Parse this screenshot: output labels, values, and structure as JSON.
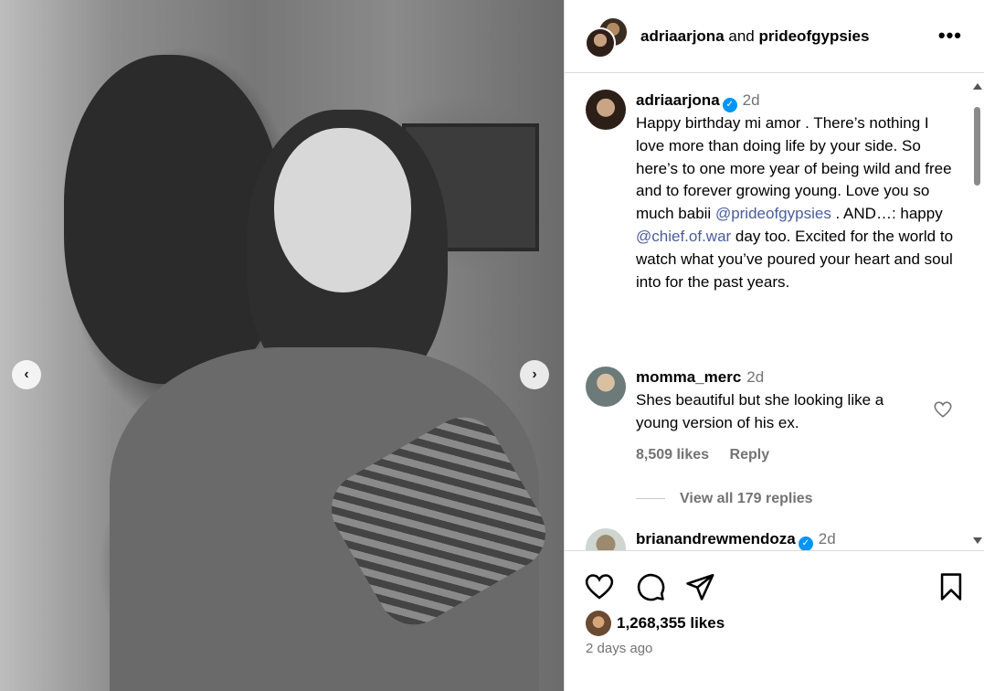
{
  "header": {
    "user1": "adriaarjona",
    "joiner": "and",
    "user2": "prideofgypsies",
    "more_label": "•••"
  },
  "photo": {
    "prev_label": "‹",
    "next_label": "›"
  },
  "caption": {
    "username": "adriaarjona",
    "verified_icon": "verified-badge-icon",
    "time": "2d",
    "text_1": "Happy birthday mi amor . There’s nothing I love more than doing life by your side. So here’s to one more year of being wild and free and to forever growing young. Love you so much babii ",
    "mention_1": "@prideofgypsies",
    "text_2": " . AND…: happy ",
    "mention_2": "@chief.of.war",
    "text_3": " day too. Excited for the world to watch what you’ve poured your heart and soul into for the past years."
  },
  "comments": [
    {
      "username": "momma_merc",
      "time": "2d",
      "text": "Shes beautiful but she looking like a young version of his ex.",
      "likes": "8,509 likes",
      "reply": "Reply",
      "view_replies": "View all 179 replies"
    },
    {
      "username": "brianandrewmendoza",
      "time": "2d"
    }
  ],
  "actions": {
    "likes": "1,268,355 likes",
    "posted": "2 days ago"
  },
  "colors": {
    "mention": "#4a5d9c",
    "verified": "#0095f6",
    "muted": "#737373",
    "border": "#dbdbdb"
  }
}
